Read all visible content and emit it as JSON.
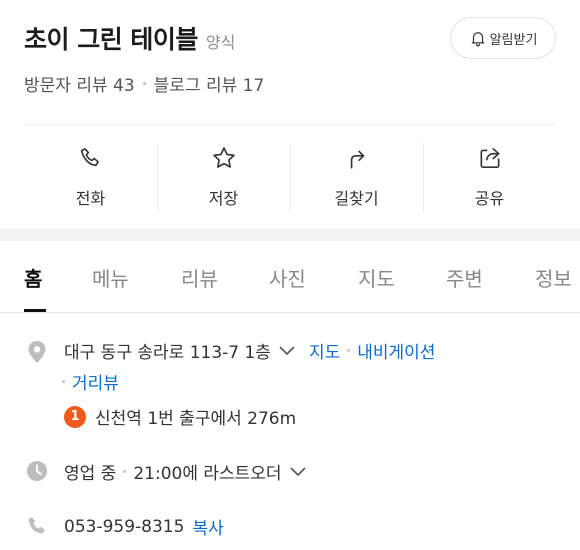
{
  "header": {
    "name": "초이 그린 테이블",
    "category": "양식",
    "notify_label": "알림받기",
    "visitor_reviews": "방문자 리뷰 43",
    "blog_reviews": "블로그 리뷰 17"
  },
  "actions": [
    {
      "label": "전화",
      "icon": "phone-icon"
    },
    {
      "label": "저장",
      "icon": "star-icon"
    },
    {
      "label": "길찾기",
      "icon": "directions-icon"
    },
    {
      "label": "공유",
      "icon": "share-icon"
    }
  ],
  "tabs": [
    {
      "label": "홈",
      "active": true
    },
    {
      "label": "메뉴"
    },
    {
      "label": "리뷰"
    },
    {
      "label": "사진"
    },
    {
      "label": "지도"
    },
    {
      "label": "주변"
    },
    {
      "label": "정보"
    }
  ],
  "info": {
    "address": "대구 동구 송라로 113-7 1층",
    "map_link": "지도",
    "navigation_link": "내비게이션",
    "street_view_link": "거리뷰",
    "station_number": "1",
    "station_text": "신천역 1번 출구에서 276m",
    "hours_status": "영업 중",
    "hours_detail": "21:00에 라스트오더",
    "phone": "053-959-8315",
    "copy_label": "복사"
  },
  "colors": {
    "link": "#0b6bcb",
    "station_badge": "#f25a1d",
    "icon_gray": "#bdbdbd"
  }
}
